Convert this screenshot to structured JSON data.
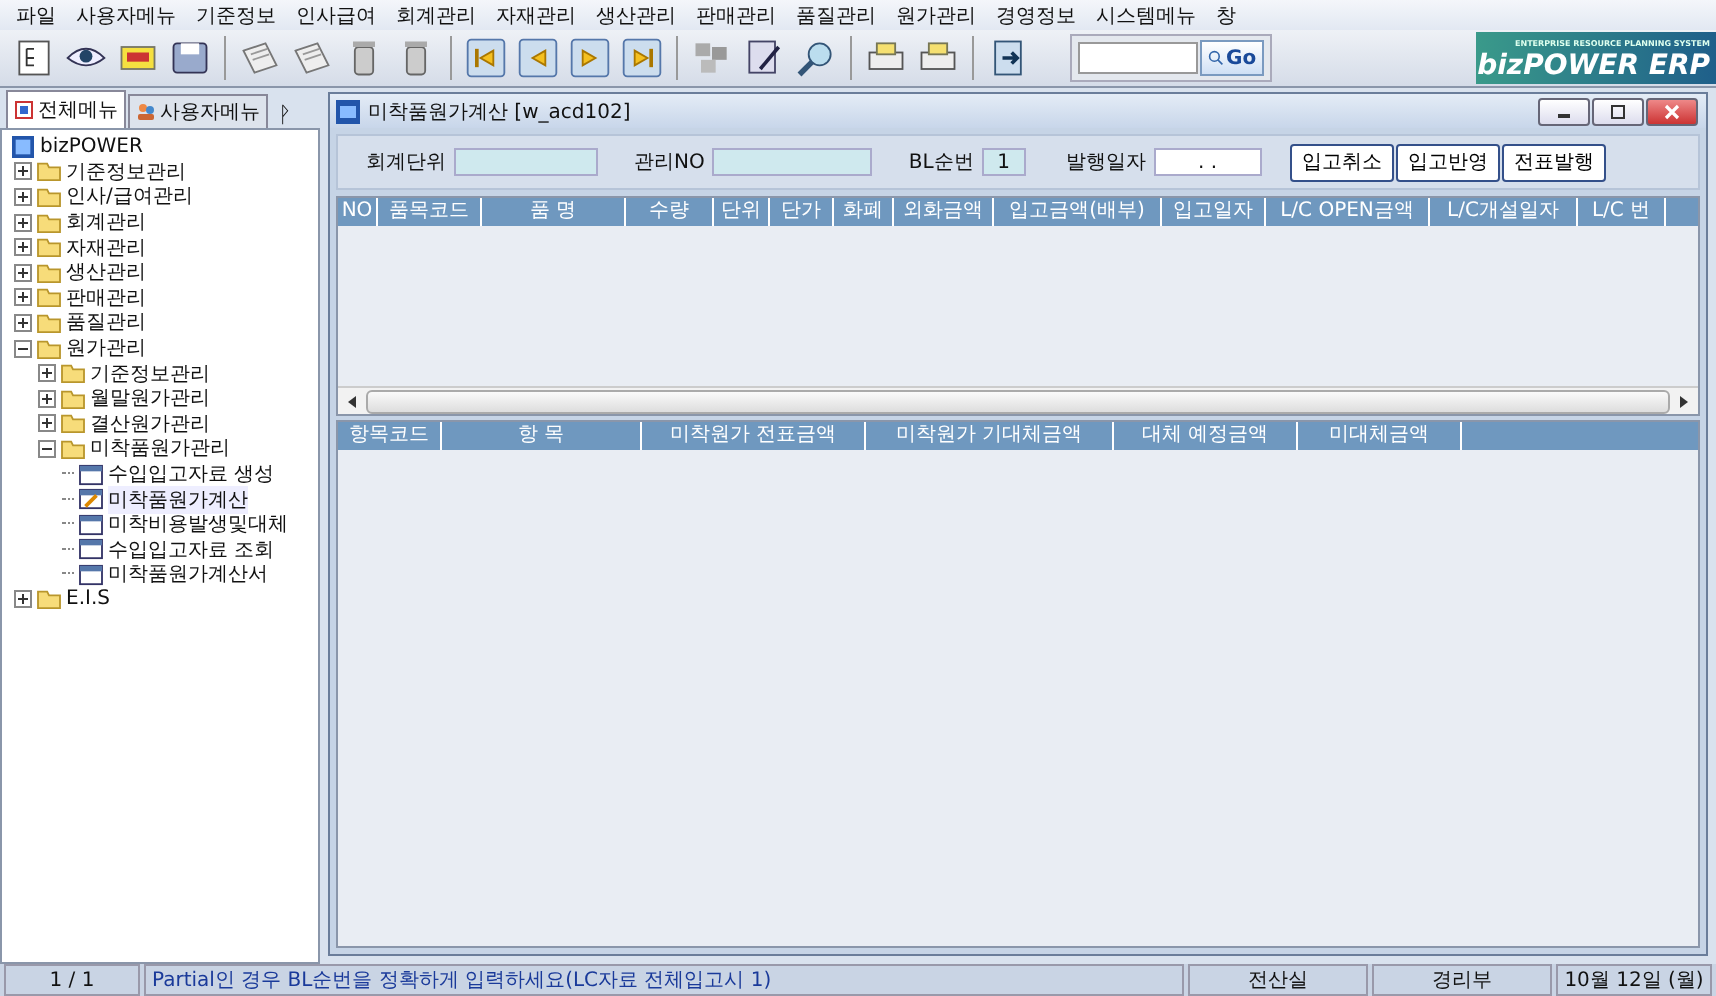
{
  "menu_bar": [
    "파일",
    "사용자메뉴",
    "기준정보",
    "인사급여",
    "회계관리",
    "자재관리",
    "생산관리",
    "판매관리",
    "품질관리",
    "원가관리",
    "경영정보",
    "시스템메뉴",
    "창"
  ],
  "toolbar": {
    "go_button": "Go",
    "logo": {
      "tagline": "ENTERPRISE RESOURCE PLANNING SYSTEM",
      "name": "bizPOWER ERP"
    }
  },
  "sidebar": {
    "tabs": [
      {
        "label": "전체메뉴",
        "selected": true
      },
      {
        "label": "사용자메뉴",
        "selected": false
      }
    ],
    "pin": "ᚹ",
    "tree": [
      {
        "label": "bizPOWER",
        "kind": "root",
        "children": [
          {
            "label": "기준정보관리",
            "kind": "folder",
            "expanded": false
          },
          {
            "label": "인사/급여관리",
            "kind": "folder",
            "expanded": false
          },
          {
            "label": "회계관리",
            "kind": "folder",
            "expanded": false
          },
          {
            "label": "자재관리",
            "kind": "folder",
            "expanded": false
          },
          {
            "label": "생산관리",
            "kind": "folder",
            "expanded": false
          },
          {
            "label": "판매관리",
            "kind": "folder",
            "expanded": false
          },
          {
            "label": "품질관리",
            "kind": "folder",
            "expanded": false
          },
          {
            "label": "원가관리",
            "kind": "folder",
            "expanded": true,
            "children": [
              {
                "label": "기준정보관리",
                "kind": "folder",
                "expanded": false
              },
              {
                "label": "월말원가관리",
                "kind": "folder",
                "expanded": false
              },
              {
                "label": "결산원가관리",
                "kind": "folder",
                "expanded": false
              },
              {
                "label": "미착품원가관리",
                "kind": "folder",
                "expanded": true,
                "children": [
                  {
                    "label": "수입입고자료 생성",
                    "kind": "form",
                    "selected": false
                  },
                  {
                    "label": "미착품원가계산",
                    "kind": "form",
                    "selected": true
                  },
                  {
                    "label": "미착비용발생및대체",
                    "kind": "form",
                    "selected": false
                  },
                  {
                    "label": "수입입고자료 조회",
                    "kind": "form",
                    "selected": false
                  },
                  {
                    "label": "미착품원가계산서",
                    "kind": "form",
                    "selected": false
                  }
                ]
              }
            ]
          },
          {
            "label": "E.I.S",
            "kind": "folder",
            "expanded": false
          }
        ]
      }
    ]
  },
  "window": {
    "title": "미착품원가계산 [w_acd102]",
    "form": {
      "accounting_unit": {
        "label": "회계단위"
      },
      "management_no": {
        "label": "관리NO"
      },
      "bl_seq": {
        "label": "BL순번",
        "value": "1"
      },
      "issue_date": {
        "label": "발행일자",
        "value": ". ."
      }
    },
    "buttons": [
      "입고취소",
      "입고반영",
      "전표발행"
    ],
    "table": {
      "columns": [
        "NO",
        "품목코드",
        "품 명",
        "수량",
        "단위",
        "단가",
        "화폐",
        "외화금액",
        "입고금액(배부)",
        "입고일자",
        "L/C OPEN금액",
        "L/C개설일자",
        "L/C 번"
      ]
    },
    "summary_table": {
      "columns": [
        "항목코드",
        "항 목",
        "미착원가 전표금액",
        "미착원가 기대체금액",
        "대체 예정금액",
        "미대체금액"
      ]
    }
  },
  "status_bar": {
    "page": "1 / 1",
    "message": "Partial인 경우 BL순번을 정확하게 입력하세요(LC자료 전체입고시 1)",
    "department": "전산실",
    "team": "경리부",
    "date": "10월 12일 (월)"
  }
}
